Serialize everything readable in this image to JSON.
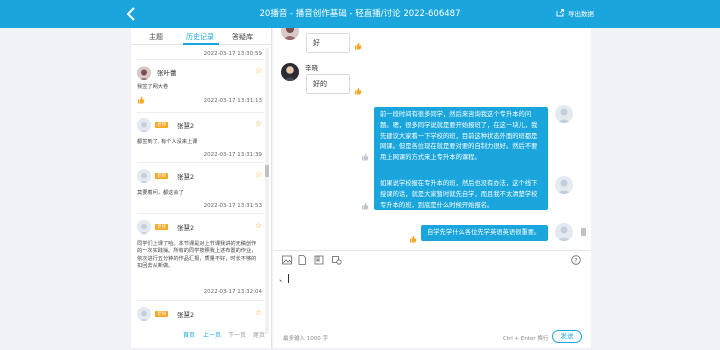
{
  "header": {
    "title": "20播音 - 播音创作基础 - 轻直播/讨论 2022-606487",
    "export_label": "导出数据",
    "colors": {
      "bar": "#1aa6dd"
    }
  },
  "tabs": [
    "主题",
    "历史记录",
    "答疑库"
  ],
  "feed": {
    "posts": [
      {
        "time": "2022-03-17 13:30:59"
      },
      {
        "name": "张叶蕾",
        "text": "我签了网大卷",
        "time": "2022-03-17 13:31:13"
      },
      {
        "badge": "老师",
        "name": "张慧2",
        "text": "都签到了, 有个人没来上课",
        "time": "2022-03-17 13:31:39"
      },
      {
        "badge": "老师",
        "name": "张慧2",
        "text": "莫要着问，都这会了",
        "time": "2022-03-17 13:31:53"
      },
      {
        "badge": "老师",
        "name": "张慧2",
        "text": "同学们上课了哈。本节课是对上节课我讲的无稿创作的一次实践操。所有的同学按照我上述布置的作业，依次进行五分钟的作品汇报，质量不好，时长不够的扣回去从新做。",
        "time": "2022-03-17 13:32:04"
      },
      {
        "badge": "老师",
        "name": "张慧2"
      }
    ]
  },
  "pager": {
    "first": "首页",
    "prev": "上一页",
    "next": "下一页",
    "last": "尾页"
  },
  "chat": {
    "messages_left": [
      {
        "text": "好"
      },
      {
        "name": "辛晓",
        "text": "好的"
      }
    ],
    "messages_right": [
      {
        "text": "前一段时间有很多同学，然后来咨询我这个专升本的问题。嗯，很多同学说就是要开始报班了，在这一块儿，我先建议大家看一下学校的班，目前这种状态外面的班都是网课。但是各位现在就是要对要的自制力很好。然后不要用上网课的方式来上专升本的课程。"
      },
      {
        "text": "如果说学校报在专升本的班，然后也没有办法，这个线下授课的话，就是大家暂时就先自学，而且我不太清楚学校专升本的班，到底是什么时候开始报名。"
      },
      {
        "text": "自学先学什么各位先学英语英语很重要。"
      }
    ]
  },
  "editor": {
    "input_value": "、",
    "limit_hint": "最多输入 1000 字",
    "shortcut_hint": "Ctrl + Enter 换行",
    "send_label": "发送"
  }
}
